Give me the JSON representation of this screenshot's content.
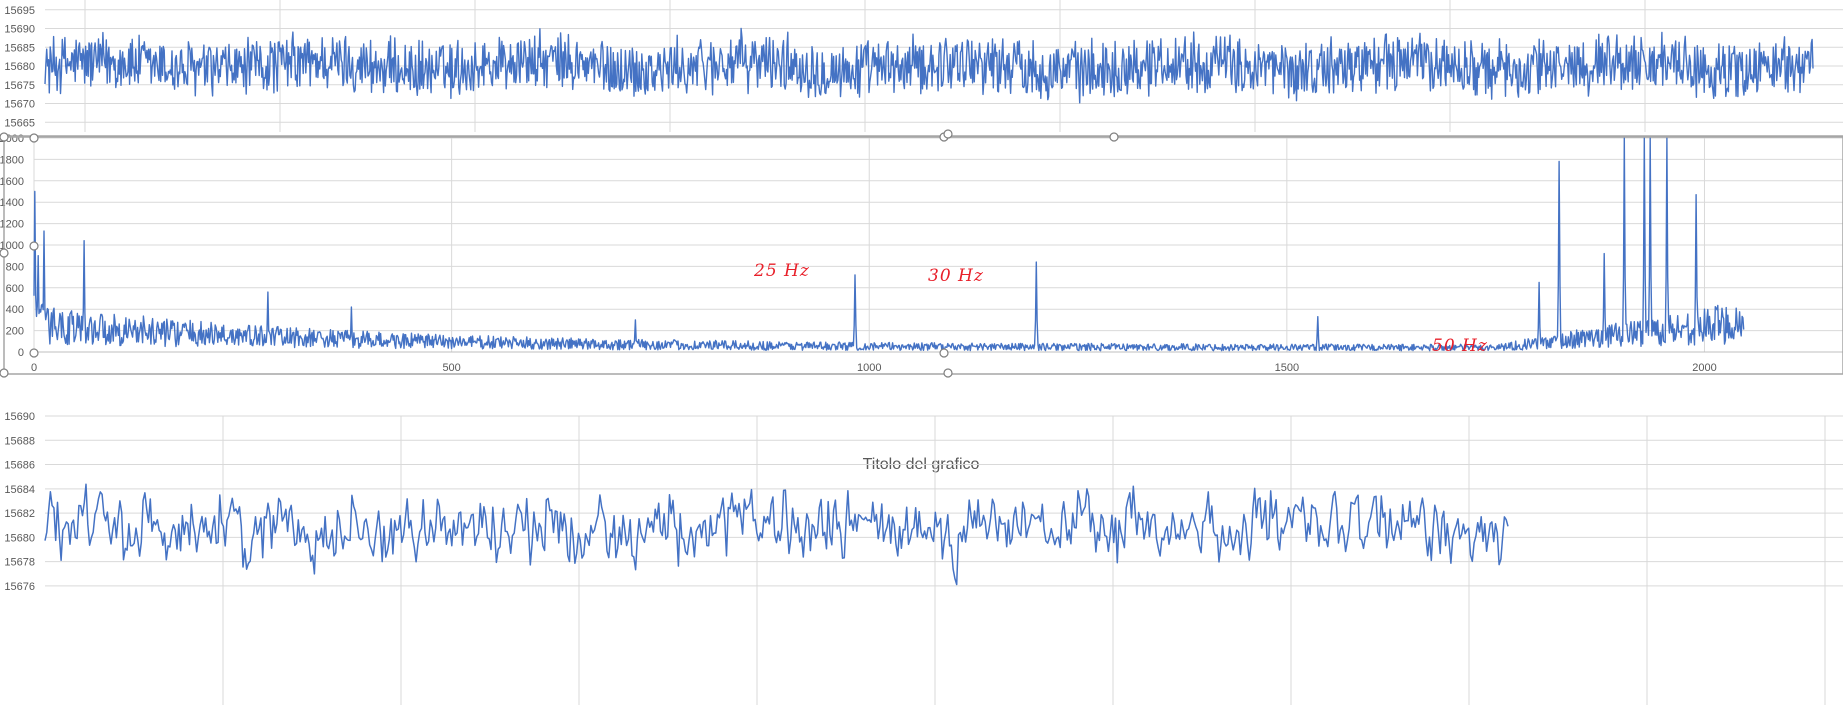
{
  "colors": {
    "series": "#4472C4",
    "grid": "#D9D9D9",
    "axis": "#595959",
    "annotation": "#E8202A",
    "handle": "#7F7F7F",
    "title": "#595959"
  },
  "chart_data": [
    {
      "type": "line",
      "title": "",
      "grid": true,
      "ylim": [
        15664,
        15696
      ],
      "ytick_labels": [
        "15665",
        "15670",
        "15675",
        "15680",
        "15685",
        "15690",
        "15695"
      ],
      "x_range": [
        0,
        2047
      ],
      "series": [
        {
          "color": "#4472C4",
          "mean": 15680,
          "swing": 9
        }
      ]
    },
    {
      "type": "line",
      "title": "",
      "grid": true,
      "ylim": [
        0,
        2000
      ],
      "ytick_labels": [
        "0",
        "200",
        "400",
        "600",
        "800",
        "1000",
        "1200",
        "1400",
        "1600",
        "1800",
        "2000"
      ],
      "xlim": [
        0,
        2100
      ],
      "xtick_labels": [
        "0",
        "500",
        "1000",
        "1500",
        "2000"
      ],
      "x_range": [
        0,
        2047
      ],
      "peaks": [
        {
          "x": 1,
          "y": 1500
        },
        {
          "x": 5,
          "y": 900
        },
        {
          "x": 12,
          "y": 1130
        },
        {
          "x": 60,
          "y": 1040
        },
        {
          "x": 280,
          "y": 560
        },
        {
          "x": 380,
          "y": 420
        },
        {
          "x": 720,
          "y": 300
        },
        {
          "x": 983,
          "y": 720
        },
        {
          "x": 1200,
          "y": 840
        },
        {
          "x": 1537,
          "y": 330
        },
        {
          "x": 1802,
          "y": 650
        },
        {
          "x": 1826,
          "y": 1780
        },
        {
          "x": 1880,
          "y": 920
        },
        {
          "x": 1904,
          "y": 2000
        },
        {
          "x": 1928,
          "y": 2000
        },
        {
          "x": 1935,
          "y": 2000
        },
        {
          "x": 1955,
          "y": 2000
        },
        {
          "x": 1990,
          "y": 1470
        },
        {
          "x": 2038,
          "y": 370
        }
      ],
      "annotations": [
        {
          "text": "25 Hz"
        },
        {
          "text": "30 Hz"
        },
        {
          "text": "50 Hz"
        }
      ]
    },
    {
      "type": "line",
      "title": "Titolo del grafico",
      "grid": true,
      "ylim": [
        15675.5,
        15690
      ],
      "ytick_labels": [
        "15676",
        "15678",
        "15680",
        "15682",
        "15684",
        "15686",
        "15688",
        "15690"
      ],
      "x_range": [
        0,
        820
      ],
      "series": [
        {
          "color": "#4472C4",
          "mean": 15680.8,
          "swing": 3.4
        }
      ]
    }
  ]
}
